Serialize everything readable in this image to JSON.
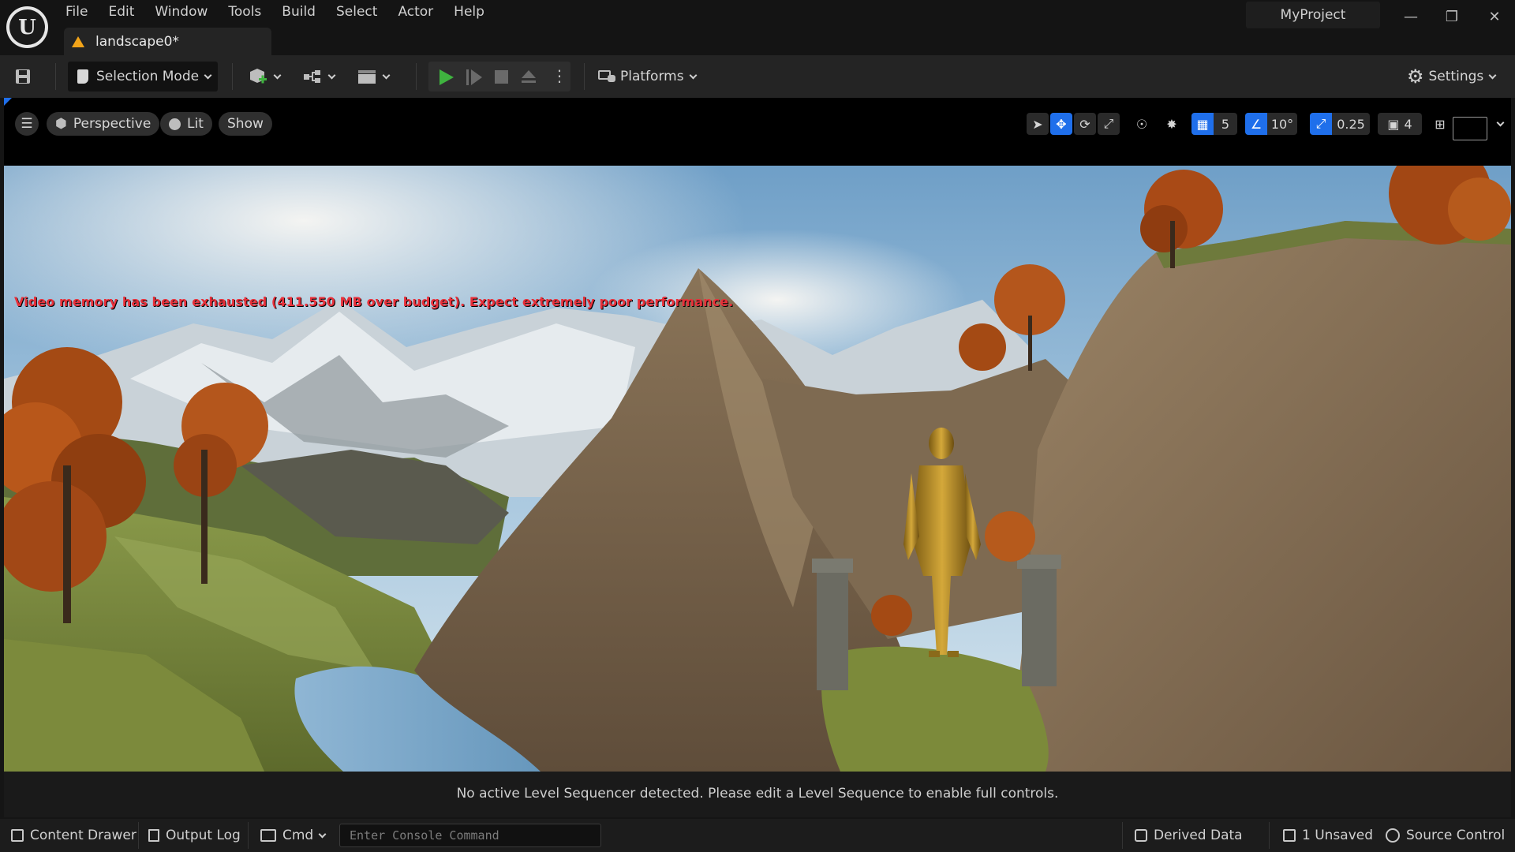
{
  "menu": [
    "File",
    "Edit",
    "Window",
    "Tools",
    "Build",
    "Select",
    "Actor",
    "Help"
  ],
  "doc_tab": "landscape0*",
  "project_name": "MyProject",
  "toolbar": {
    "selection_mode": "Selection Mode",
    "platforms": "Platforms",
    "settings": "Settings"
  },
  "viewport": {
    "perspective": "Perspective",
    "lit": "Lit",
    "show": "Show",
    "grid_snap": "5",
    "rotation_snap": "10°",
    "scale_snap": "0.25",
    "camera_speed": "4"
  },
  "warning": "Video memory has been exhausted (411.550 MB over budget). Expect extremely poor performance.",
  "sequencer_message": "No active Level Sequencer detected. Please edit a Level Sequence to enable full controls.",
  "statusbar": {
    "content_drawer": "Content Drawer",
    "output_log": "Output Log",
    "cmd": "Cmd",
    "console_placeholder": "Enter Console Command",
    "derived_data": "Derived Data",
    "unsaved": "1 Unsaved",
    "source_control": "Source Control"
  },
  "colors": {
    "accent": "#1f6feb",
    "play": "#3fb33f",
    "warning": "#e8303a",
    "tab_warning": "#f2a419"
  }
}
